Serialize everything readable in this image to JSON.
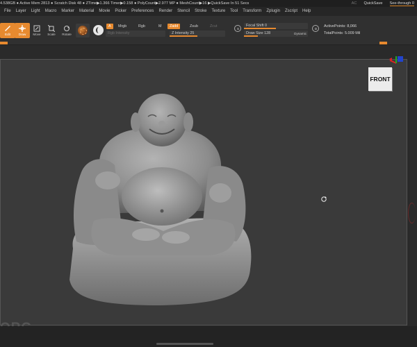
{
  "statusbar": {
    "info": "4.538GB ● Active Mem 2813 ● Scratch Disk 48 ● ZTime▶1.366 Timer▶0.158 ● PolyCount▶2.977 MP ● MeshCount▶16 ▶QuickSave In 51 Secs",
    "ac": "AC",
    "quicksave": "QuickSave",
    "see_through_label": "See-through",
    "see_through_value": "0"
  },
  "menu": [
    "File",
    "Layer",
    "Light",
    "Macro",
    "Marker",
    "Material",
    "Movie",
    "Picker",
    "Preferences",
    "Render",
    "Stencil",
    "Stroke",
    "Texture",
    "Tool",
    "Transform",
    "Zplugin",
    "Zscript",
    "Help"
  ],
  "toolbar": {
    "edit": "Edit",
    "draw": "Draw",
    "move": "Move",
    "scale": "Scale",
    "rotate": "Rotate",
    "a_label": "A",
    "mrgb": "Mrgb",
    "rgb": "Rgb",
    "m": "M",
    "rgb_intensity": "Rgb Intensity",
    "zadd": "Zadd",
    "zsub": "Zsub",
    "zcut": "Zcut",
    "z_intensity_label": "Z Intensity",
    "z_intensity_value": "25",
    "focal_shift_label": "Focal Shift",
    "focal_shift_value": "0",
    "draw_size_label": "Draw Size",
    "draw_size_value": "128",
    "dynamic": "Dynamic",
    "active_points_label": "ActivePoints:",
    "active_points_value": "8,066",
    "total_points_label": "TotalPoints:",
    "total_points_value": "5.009 Mil",
    "icon_s": "S",
    "icon_d": "D"
  },
  "viewport": {
    "view_label": "FRONT",
    "watermark": "ORG"
  },
  "colors": {
    "accent": "#e78a2f",
    "background": "#2a2a2a",
    "canvas": "#3a3a3a"
  }
}
